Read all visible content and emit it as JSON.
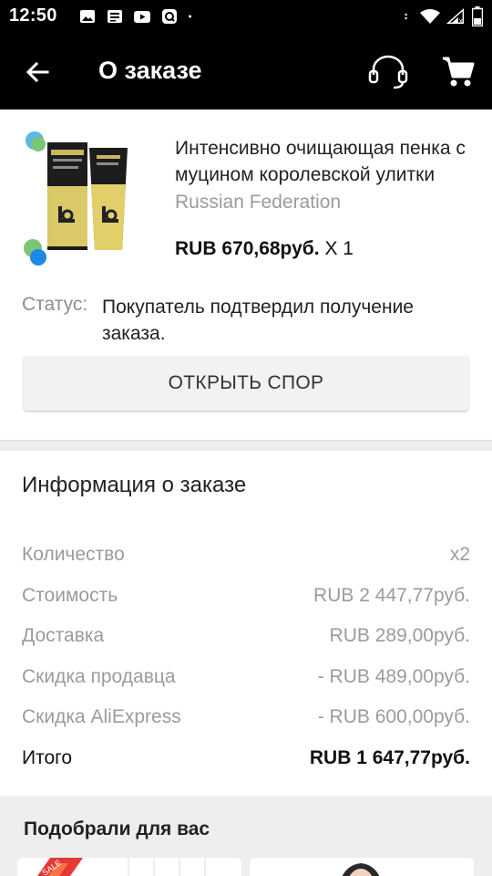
{
  "status_bar": {
    "time": "12:50",
    "left_icons": [
      "image-icon",
      "news-icon",
      "youtube-icon",
      "assistant-icon",
      "dot-icon"
    ],
    "right_icons": [
      "data-transfer-icon",
      "wifi-icon",
      "signal-icon",
      "battery-icon"
    ]
  },
  "app_bar": {
    "title": "О заказе",
    "icons": [
      "back-arrow-icon",
      "support-headset-icon",
      "cart-icon"
    ]
  },
  "product": {
    "title": "Интенсивно очищающая пенка с муцином королевской улитки",
    "origin": "Russian Federation",
    "price": "RUB 670,68руб.",
    "quantity": " X 1",
    "status_label": "Статус:",
    "status_text": "Покупатель подтвердил получение заказа.",
    "dispute_button": "ОТКРЫТЬ СПОР"
  },
  "order_info": {
    "title": "Информация о заказе",
    "rows": [
      {
        "label": "Количество",
        "value": "x2"
      },
      {
        "label": "Стоимость",
        "value": "RUB 2 447,77руб."
      },
      {
        "label": "Доставка",
        "value": "RUB 289,00руб."
      },
      {
        "label": "Скидка продавца",
        "value": "- RUB 489,00руб."
      },
      {
        "label": "Скидка AliExpress",
        "value": "- RUB 600,00руб."
      }
    ],
    "total": {
      "label": "Итого",
      "value": "RUB 1 647,77руб."
    }
  },
  "recommendations": {
    "title": "Подобрали для вас",
    "badge": "SALE"
  },
  "colors": {
    "bar_background": "#000000",
    "muted_text": "#9b9b9b",
    "section_gray": "#eeeeee",
    "product_gold": "#d9c968"
  }
}
